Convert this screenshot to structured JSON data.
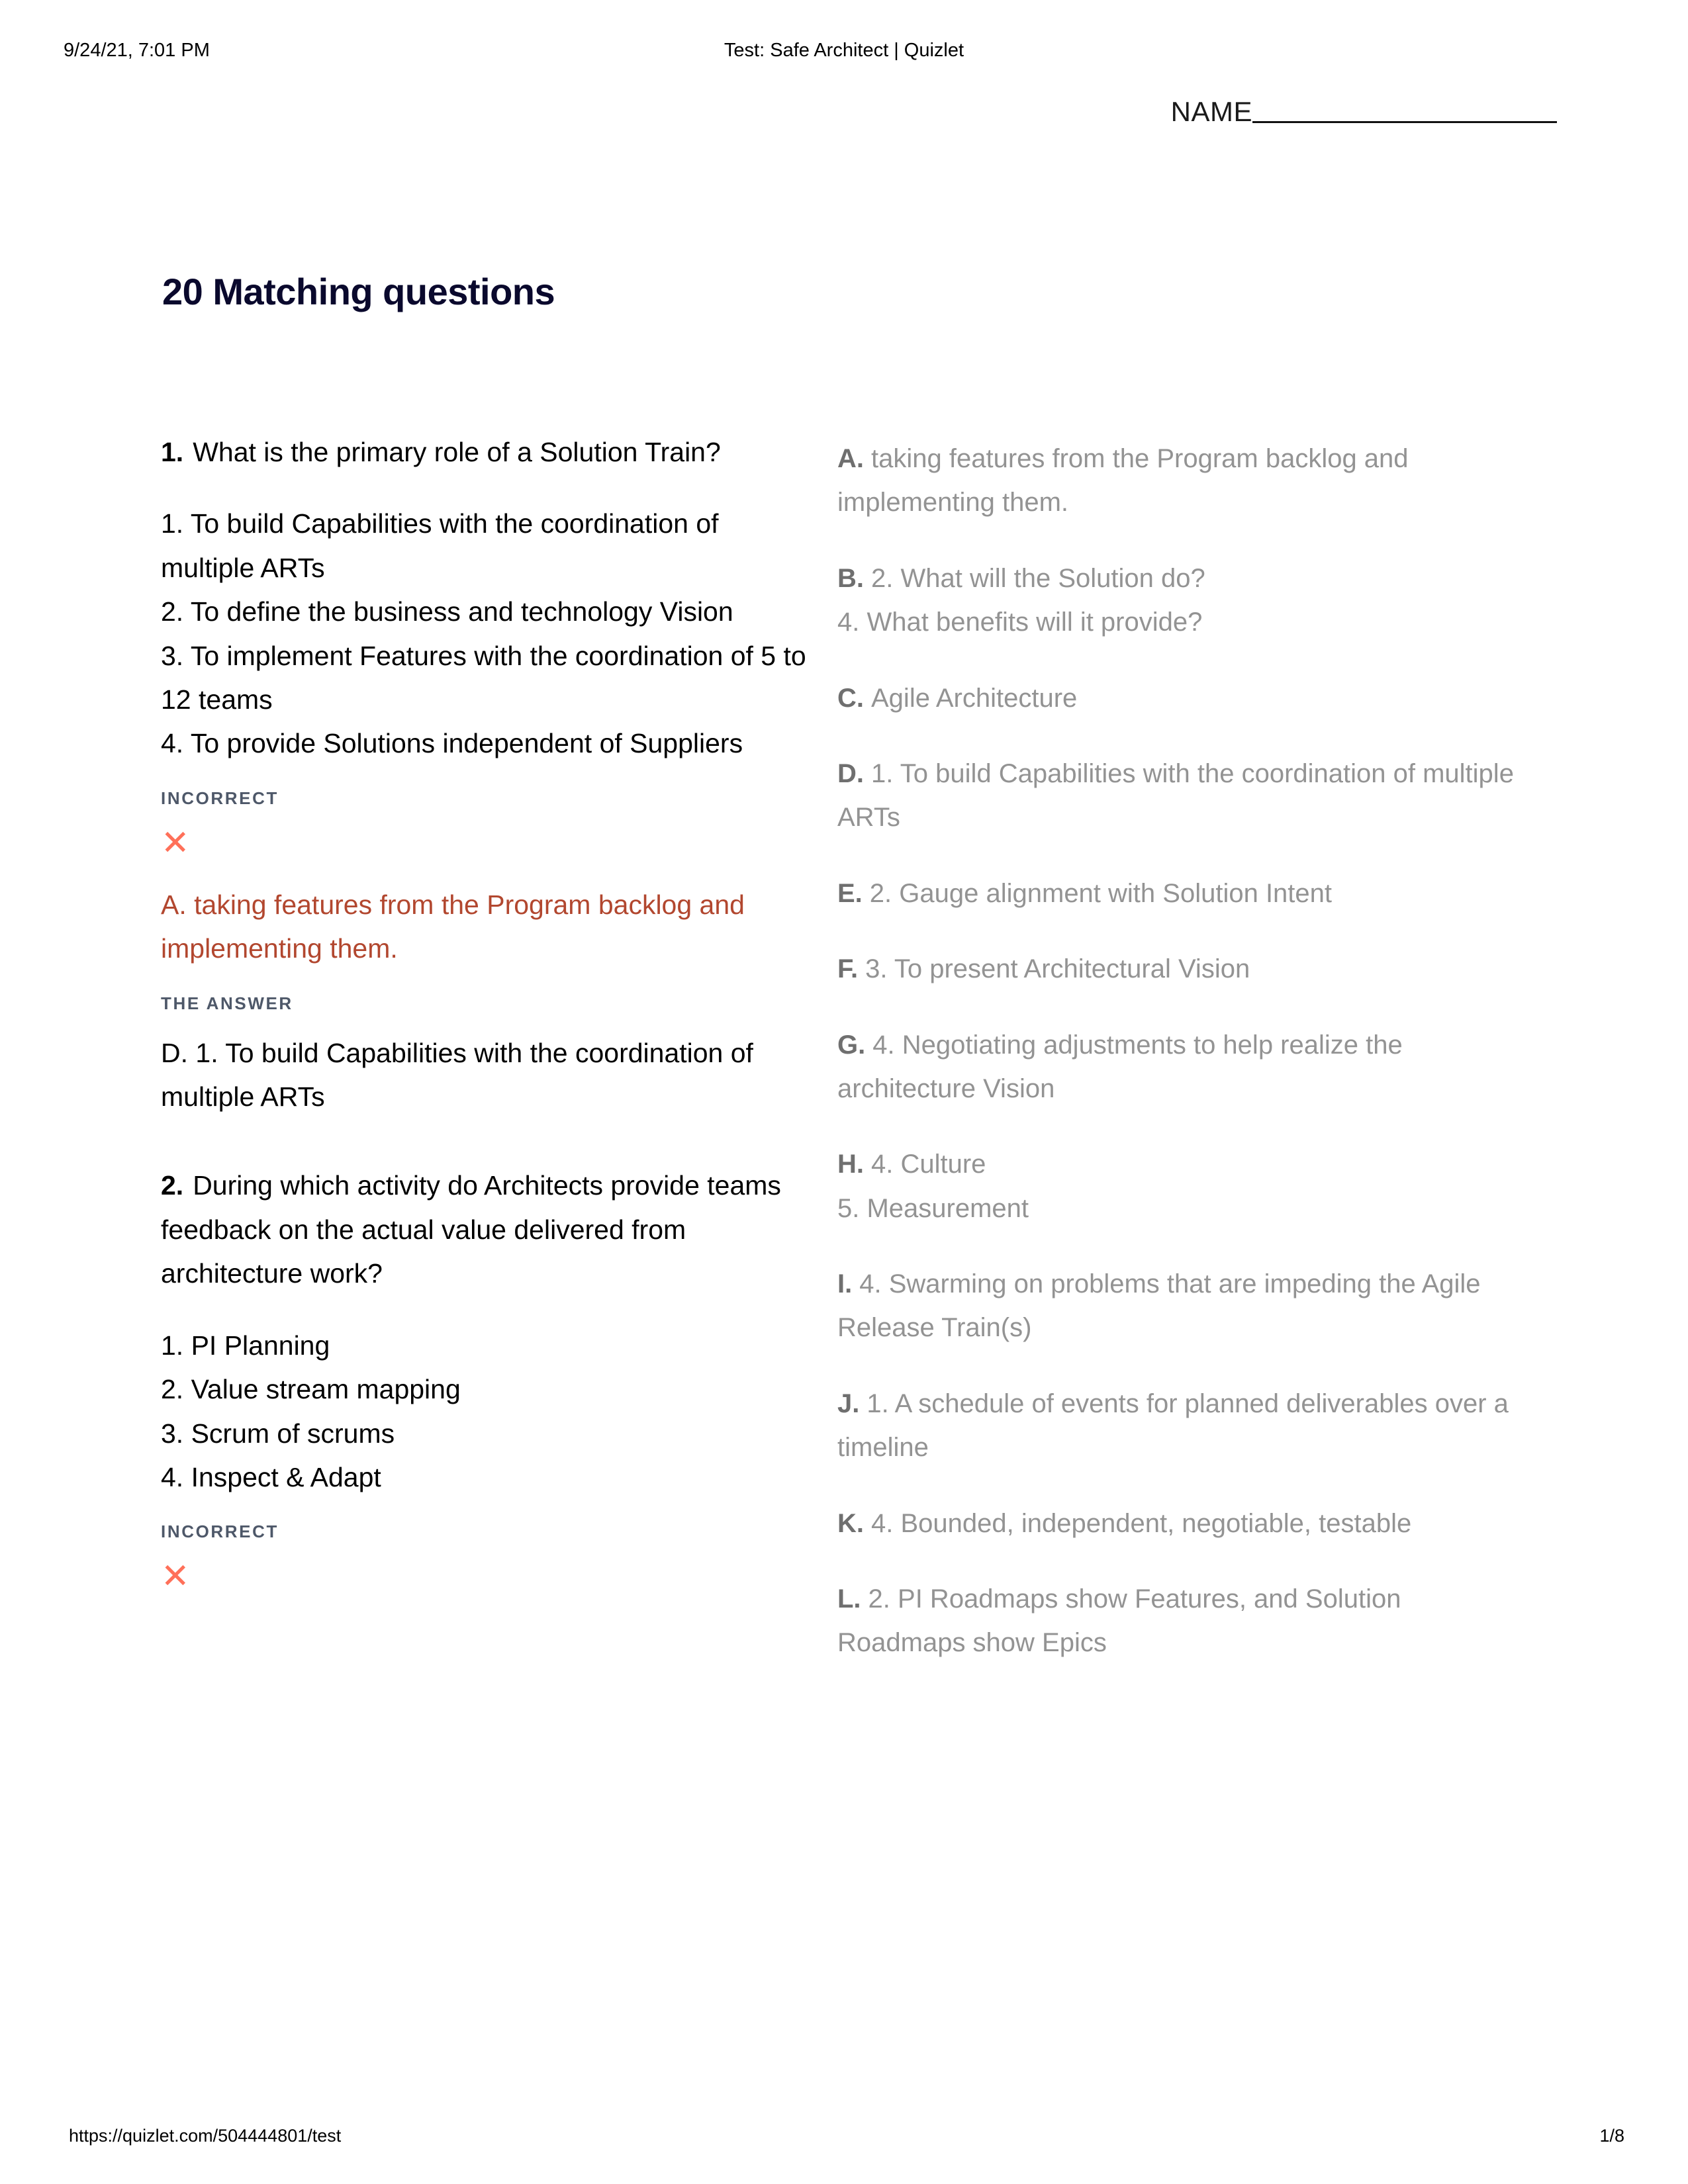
{
  "print_header": {
    "timestamp": "9/24/21, 7:01 PM",
    "document_title": "Test: Safe Architect | Quizlet"
  },
  "print_footer": {
    "url": "https://quizlet.com/504444801/test",
    "page_number": "1/8"
  },
  "name_field": {
    "label": "NAME",
    "blank": "__________________"
  },
  "test": {
    "title": "20 Matching questions",
    "status_labels": {
      "incorrect": "INCORRECT",
      "the_answer": "THE ANSWER"
    },
    "mark_icon": "✕"
  },
  "questions": [
    {
      "number": "1.",
      "prompt": "What is the primary role of a Solution Train?",
      "options": "1. To build Capabilities with the coordination of multiple ARTs\n2. To define the business and technology Vision\n3. To implement Features with the coordination of 5 to 12 teams\n4. To provide Solutions independent of Suppliers",
      "status": "INCORRECT",
      "given_answer": "A. taking features from the Program backlog and implementing them.",
      "answer_label": "THE ANSWER",
      "correct_answer": "D. 1. To build Capabilities with the coordination of multiple ARTs"
    },
    {
      "number": "2.",
      "prompt": "During which activity do Architects provide teams feedback on the actual value delivered from architecture work?",
      "options": "1. PI Planning\n2. Value stream mapping\n3. Scrum of scrums\n4. Inspect & Adapt",
      "status": "INCORRECT",
      "given_answer": "",
      "answer_label": "",
      "correct_answer": ""
    }
  ],
  "choices": [
    {
      "letter": "A.",
      "text": "taking features from the Program backlog and implementing them."
    },
    {
      "letter": "B.",
      "text": "2. What will the Solution do?\n4. What benefits will it provide?"
    },
    {
      "letter": "C.",
      "text": "Agile Architecture"
    },
    {
      "letter": "D.",
      "text": "1. To build Capabilities with the coordination of multiple ARTs"
    },
    {
      "letter": "E.",
      "text": "2. Gauge alignment with Solution Intent"
    },
    {
      "letter": "F.",
      "text": "3. To present Architectural Vision"
    },
    {
      "letter": "G.",
      "text": "4. Negotiating adjustments to help realize the architecture Vision"
    },
    {
      "letter": "H.",
      "text": "4. Culture\n5. Measurement"
    },
    {
      "letter": "I.",
      "text": "4. Swarming on problems that are impeding the Agile Release Train(s)"
    },
    {
      "letter": "J.",
      "text": "1. A schedule of events for planned deliverables over a timeline"
    },
    {
      "letter": "K.",
      "text": "4. Bounded, independent, negotiable, testable"
    },
    {
      "letter": "L.",
      "text": "2. PI Roadmaps show Features, and Solution Roadmaps show Epics"
    }
  ],
  "colors": {
    "incorrect_label": "#4e5869",
    "x_mark": "#ff7059",
    "given_answer": "#b2472f",
    "choice_text": "#939393",
    "choice_letter": "#6f6f6f"
  }
}
